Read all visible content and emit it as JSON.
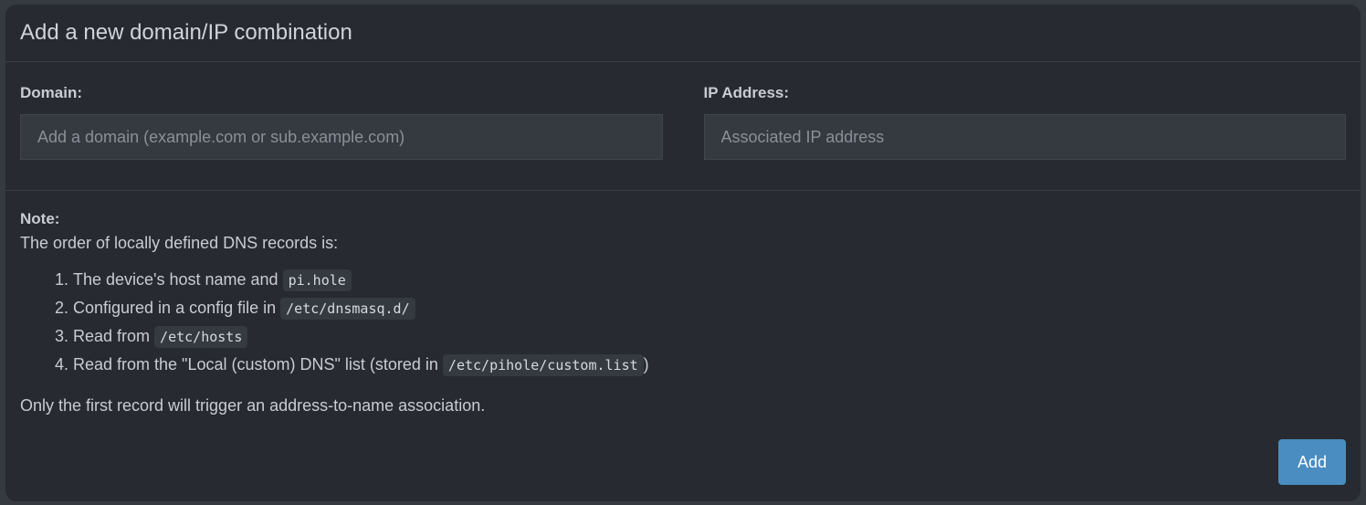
{
  "card": {
    "title": "Add a new domain/IP combination"
  },
  "form": {
    "domain": {
      "label": "Domain:",
      "placeholder": "Add a domain (example.com or sub.example.com)",
      "value": ""
    },
    "ip": {
      "label": "IP Address:",
      "placeholder": "Associated IP address",
      "value": ""
    }
  },
  "note": {
    "heading": "Note:",
    "intro": "The order of locally defined DNS records is:",
    "items": [
      {
        "text": "The device's host name and ",
        "code": "pi.hole",
        "after": ""
      },
      {
        "text": "Configured in a config file in ",
        "code": "/etc/dnsmasq.d/",
        "after": ""
      },
      {
        "text": "Read from ",
        "code": "/etc/hosts",
        "after": ""
      },
      {
        "text": "Read from the \"Local (custom) DNS\" list (stored in ",
        "code": "/etc/pihole/custom.list",
        "after": ")"
      }
    ],
    "footer": "Only the first record will trigger an address-to-name association."
  },
  "actions": {
    "add_label": "Add"
  },
  "colors": {
    "accent": "#4a8dc1",
    "card_bg": "#272a30",
    "page_bg": "#353a41"
  }
}
